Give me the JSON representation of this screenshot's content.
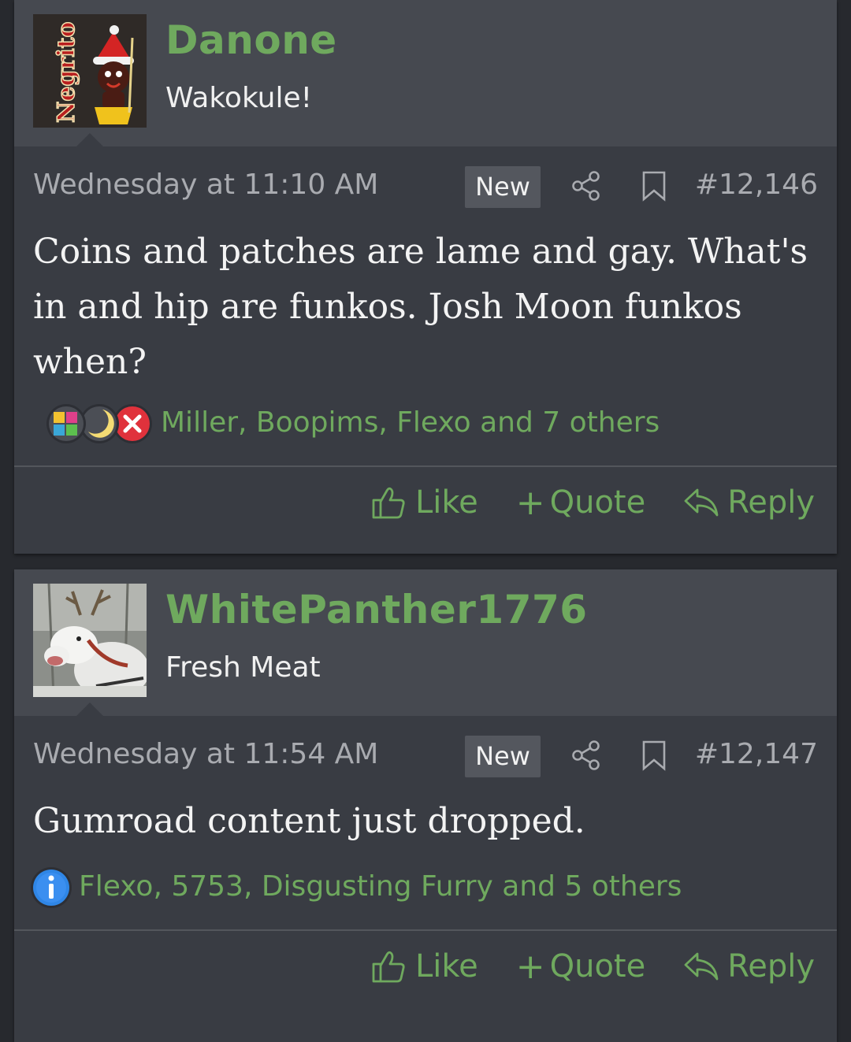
{
  "posts": [
    {
      "username": "Danone",
      "user_title": "Wakokule!",
      "avatar_text": "Negrito",
      "date": "Wednesday at 11:10 AM",
      "badge": "New",
      "post_number": "#12,146",
      "content": "Coins and patches are lame and gay. What's in and hip are funkos. Josh Moon funkos when?",
      "reaction_icons": [
        "puzzle-icon",
        "moon-icon",
        "x-icon"
      ],
      "reactions_text": "Miller, Boopims, Flexo and 7 others",
      "actions": {
        "like": "Like",
        "quote": "Quote",
        "reply": "Reply"
      }
    },
    {
      "username": "WhitePanther1776",
      "user_title": "Fresh Meat",
      "date": "Wednesday at 11:54 AM",
      "badge": "New",
      "post_number": "#12,147",
      "content": "Gumroad content just dropped.",
      "reaction_icons": [
        "info-icon"
      ],
      "reactions_text": "Flexo, 5753, Disgusting Furry and 5 others",
      "actions": {
        "like": "Like",
        "quote": "Quote",
        "reply": "Reply"
      }
    }
  ],
  "colors": {
    "accent": "#6fa95e",
    "panel": "#393c43",
    "header": "#464950",
    "background": "#27292e"
  }
}
